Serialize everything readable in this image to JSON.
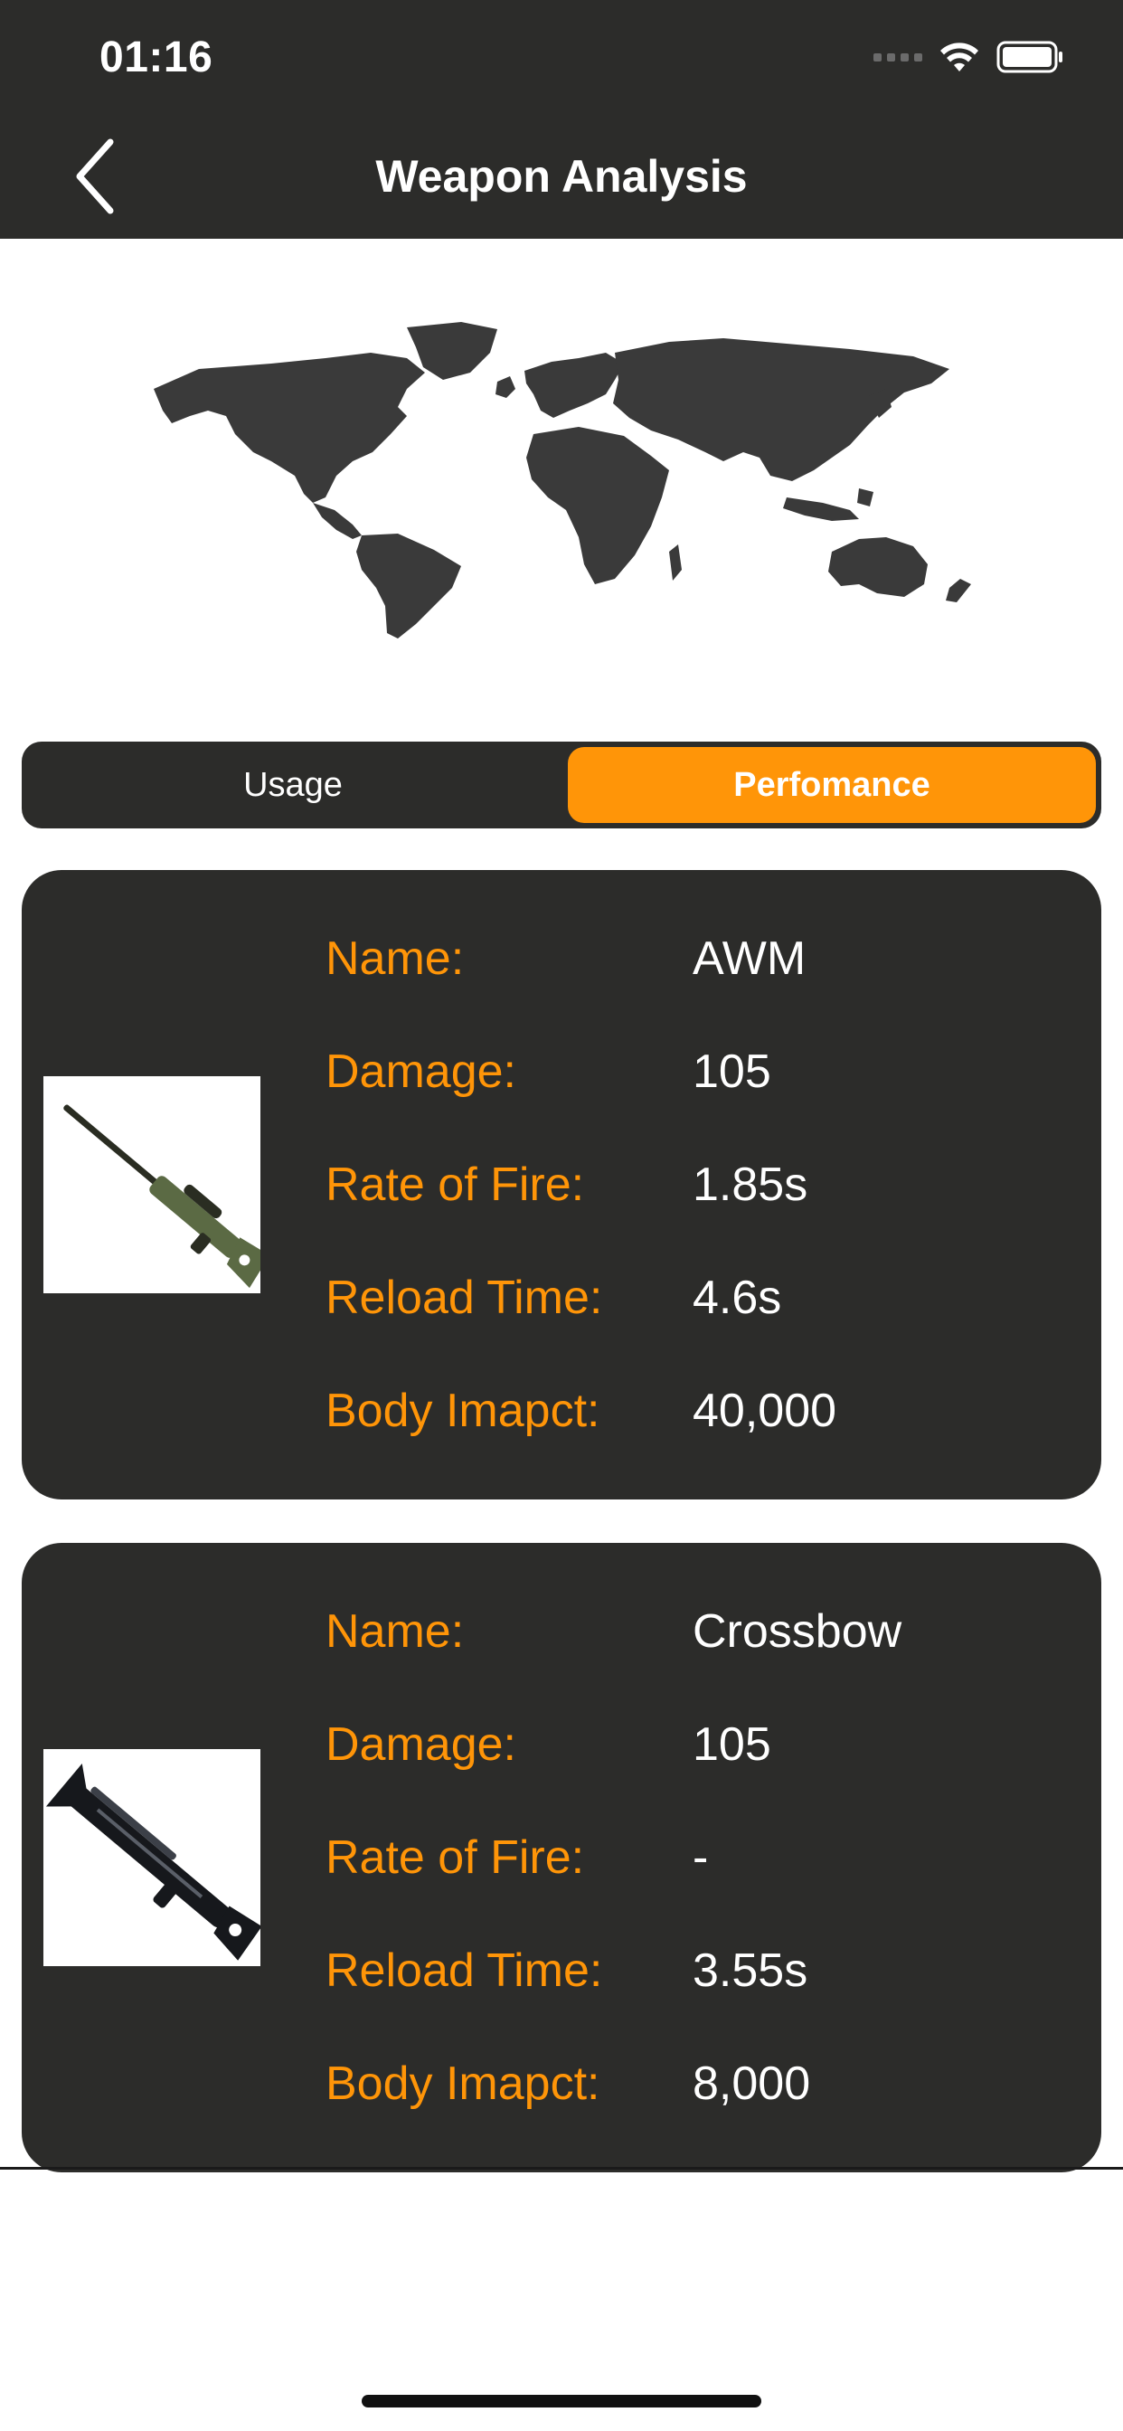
{
  "status_bar": {
    "time": "01:16",
    "icons": [
      "signal-dots-icon",
      "wifi-icon",
      "battery-icon"
    ]
  },
  "nav": {
    "back_icon": "chevron-left-icon",
    "title": "Weapon Analysis"
  },
  "map": {
    "icon": "world-map-icon"
  },
  "segmented": {
    "options": [
      "Usage",
      "Perfomance"
    ],
    "selected": "Perfomance"
  },
  "weapons": [
    {
      "image_icon": "sniper-rifle-icon",
      "rows": [
        {
          "label": "Name:",
          "value": "AWM"
        },
        {
          "label": "Damage:",
          "value": "105"
        },
        {
          "label": "Rate of Fire:",
          "value": "1.85s"
        },
        {
          "label": "Reload Time:",
          "value": "4.6s"
        },
        {
          "label": "Body Imapct:",
          "value": "40,000"
        }
      ]
    },
    {
      "image_icon": "crossbow-icon",
      "rows": [
        {
          "label": "Name:",
          "value": "Crossbow"
        },
        {
          "label": "Damage:",
          "value": "105"
        },
        {
          "label": "Rate of Fire:",
          "value": "-"
        },
        {
          "label": "Reload Time:",
          "value": "3.55s"
        },
        {
          "label": "Body Imapct:",
          "value": "8,000"
        }
      ]
    }
  ],
  "colors": {
    "header_bg": "#2c2c2a",
    "card_bg": "#2c2c2a",
    "accent": "#ff9508",
    "map_fill": "#3a3a3a"
  }
}
